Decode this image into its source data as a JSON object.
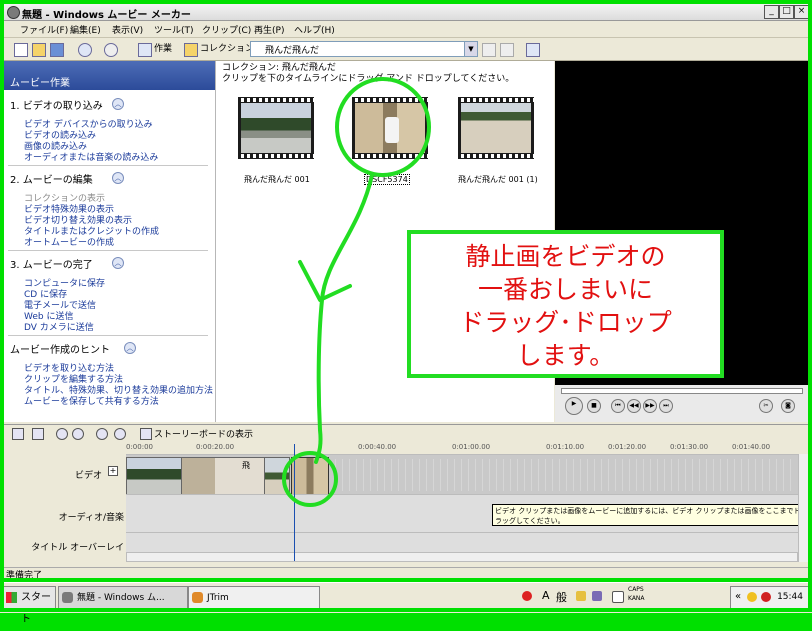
{
  "window": {
    "title": "無題 - Windows ムービー メーカー",
    "controls": [
      "_",
      "□",
      "×"
    ]
  },
  "menu": [
    "ファイル(F)",
    "編集(E)",
    "表示(V)",
    "ツール(T)",
    "クリップ(C)",
    "再生(P)",
    "ヘルプ(H)"
  ],
  "toolbar": {
    "tasks_label": "作業",
    "collections_label": "コレクション",
    "collection_combo": "飛んだ飛んだ"
  },
  "tasks_pane": {
    "header": "ムービー作業",
    "sections": [
      {
        "title": "1. ビデオの取り込み",
        "links": [
          "ビデオ デバイスからの取り込み",
          "ビデオの読み込み",
          "画像の読み込み",
          "オーディオまたは音楽の読み込み"
        ]
      },
      {
        "title": "2. ムービーの編集",
        "links": [
          "コレクションの表示",
          "ビデオ特殊効果の表示",
          "ビデオ切り替え効果の表示",
          "タイトルまたはクレジットの作成",
          "オートムービーの作成"
        ]
      },
      {
        "title": "3. ムービーの完了",
        "links": [
          "コンピュータに保存",
          "CD に保存",
          "電子メールで送信",
          "Web に送信",
          "DV カメラに送信"
        ]
      },
      {
        "title": "ムービー作成のヒント",
        "links": [
          "ビデオを取り込む方法",
          "クリップを編集する方法",
          "タイトル、特殊効果、切り替え効果の追加方法",
          "ムービーを保存して共有する方法"
        ]
      }
    ]
  },
  "collection": {
    "title": "コレクション: 飛んだ飛んだ",
    "instruction": "クリップを下のタイムラインにドラッグ アンド ドロップしてください。",
    "items": [
      "飛んだ飛んだ 001",
      "DSCF5374",
      "飛んだ飛んだ 001 (1)"
    ]
  },
  "timeline": {
    "storyboard_label": "ストーリーボードの表示",
    "ruler_ticks": [
      "0:00:00",
      "0:00:20.00",
      "0:00:40.00",
      "0:01:00.00",
      "0:01:10.00",
      "0:01:20.00",
      "0:01:30.00",
      "0:01:40.00"
    ],
    "tracks": {
      "video": "ビデオ",
      "audio": "オーディオ/音楽",
      "title": "タイトル オーバーレイ"
    },
    "clip_label": "飛",
    "tooltip": "ビデオ クリップまたは画像をムービーに追加するには、ビデオ クリップまたは画像をここまでドラッグしてください。"
  },
  "status": "準備完了",
  "taskbar": {
    "start": "スタート",
    "tasks": [
      "無題 - Windows ム...",
      "JTrim"
    ],
    "ime": [
      "A",
      "般"
    ],
    "caps_label": "CAPS",
    "kana_label": "KANA",
    "clock": "15:44"
  },
  "annotation": {
    "lines": [
      "静止画をビデオの",
      "一番おしまいに",
      "ドラッグ･ドロップ",
      "します。"
    ],
    "color": "#e21010",
    "marker_color": "#22dd22"
  }
}
